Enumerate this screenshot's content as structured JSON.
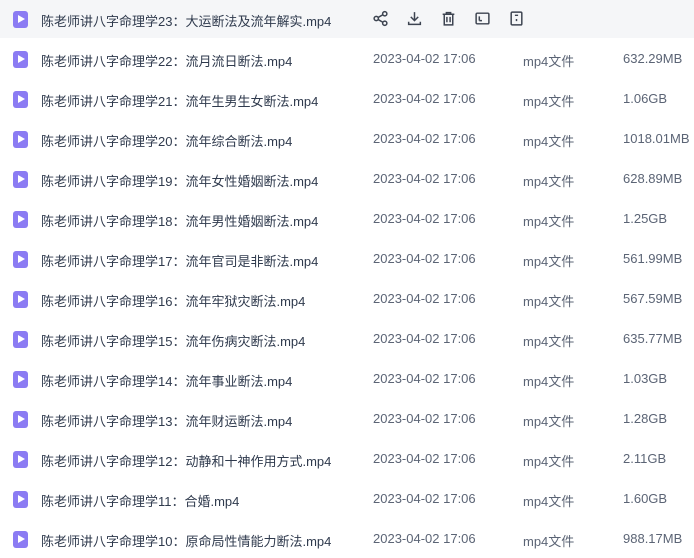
{
  "toolbar": {
    "actions": [
      {
        "name": "share-icon"
      },
      {
        "name": "download-icon"
      },
      {
        "name": "delete-icon"
      },
      {
        "name": "rename-icon"
      },
      {
        "name": "more-icon"
      }
    ]
  },
  "files": [
    {
      "name": "陈老师讲八字命理学23：大运断法及流年解实.mp4",
      "date": "",
      "type": "",
      "size": ""
    },
    {
      "name": "陈老师讲八字命理学22：流月流日断法.mp4",
      "date": "2023-04-02 17:06",
      "type": "mp4文件",
      "size": "632.29MB"
    },
    {
      "name": "陈老师讲八字命理学21：流年生男生女断法.mp4",
      "date": "2023-04-02 17:06",
      "type": "mp4文件",
      "size": "1.06GB"
    },
    {
      "name": "陈老师讲八字命理学20：流年综合断法.mp4",
      "date": "2023-04-02 17:06",
      "type": "mp4文件",
      "size": "1018.01MB"
    },
    {
      "name": "陈老师讲八字命理学19：流年女性婚姻断法.mp4",
      "date": "2023-04-02 17:06",
      "type": "mp4文件",
      "size": "628.89MB"
    },
    {
      "name": "陈老师讲八字命理学18：流年男性婚姻断法.mp4",
      "date": "2023-04-02 17:06",
      "type": "mp4文件",
      "size": "1.25GB"
    },
    {
      "name": "陈老师讲八字命理学17：流年官司是非断法.mp4",
      "date": "2023-04-02 17:06",
      "type": "mp4文件",
      "size": "561.99MB"
    },
    {
      "name": "陈老师讲八字命理学16：流年牢狱灾断法.mp4",
      "date": "2023-04-02 17:06",
      "type": "mp4文件",
      "size": "567.59MB"
    },
    {
      "name": "陈老师讲八字命理学15：流年伤病灾断法.mp4",
      "date": "2023-04-02 17:06",
      "type": "mp4文件",
      "size": "635.77MB"
    },
    {
      "name": "陈老师讲八字命理学14：流年事业断法.mp4",
      "date": "2023-04-02 17:06",
      "type": "mp4文件",
      "size": "1.03GB"
    },
    {
      "name": "陈老师讲八字命理学13：流年财运断法.mp4",
      "date": "2023-04-02 17:06",
      "type": "mp4文件",
      "size": "1.28GB"
    },
    {
      "name": "陈老师讲八字命理学12：动静和十神作用方式.mp4",
      "date": "2023-04-02 17:06",
      "type": "mp4文件",
      "size": "2.11GB"
    },
    {
      "name": "陈老师讲八字命理学11：合婚.mp4",
      "date": "2023-04-02 17:06",
      "type": "mp4文件",
      "size": "1.60GB"
    },
    {
      "name": "陈老师讲八字命理学10：原命局性情能力断法.mp4",
      "date": "2023-04-02 17:06",
      "type": "mp4文件",
      "size": "988.17MB"
    }
  ]
}
